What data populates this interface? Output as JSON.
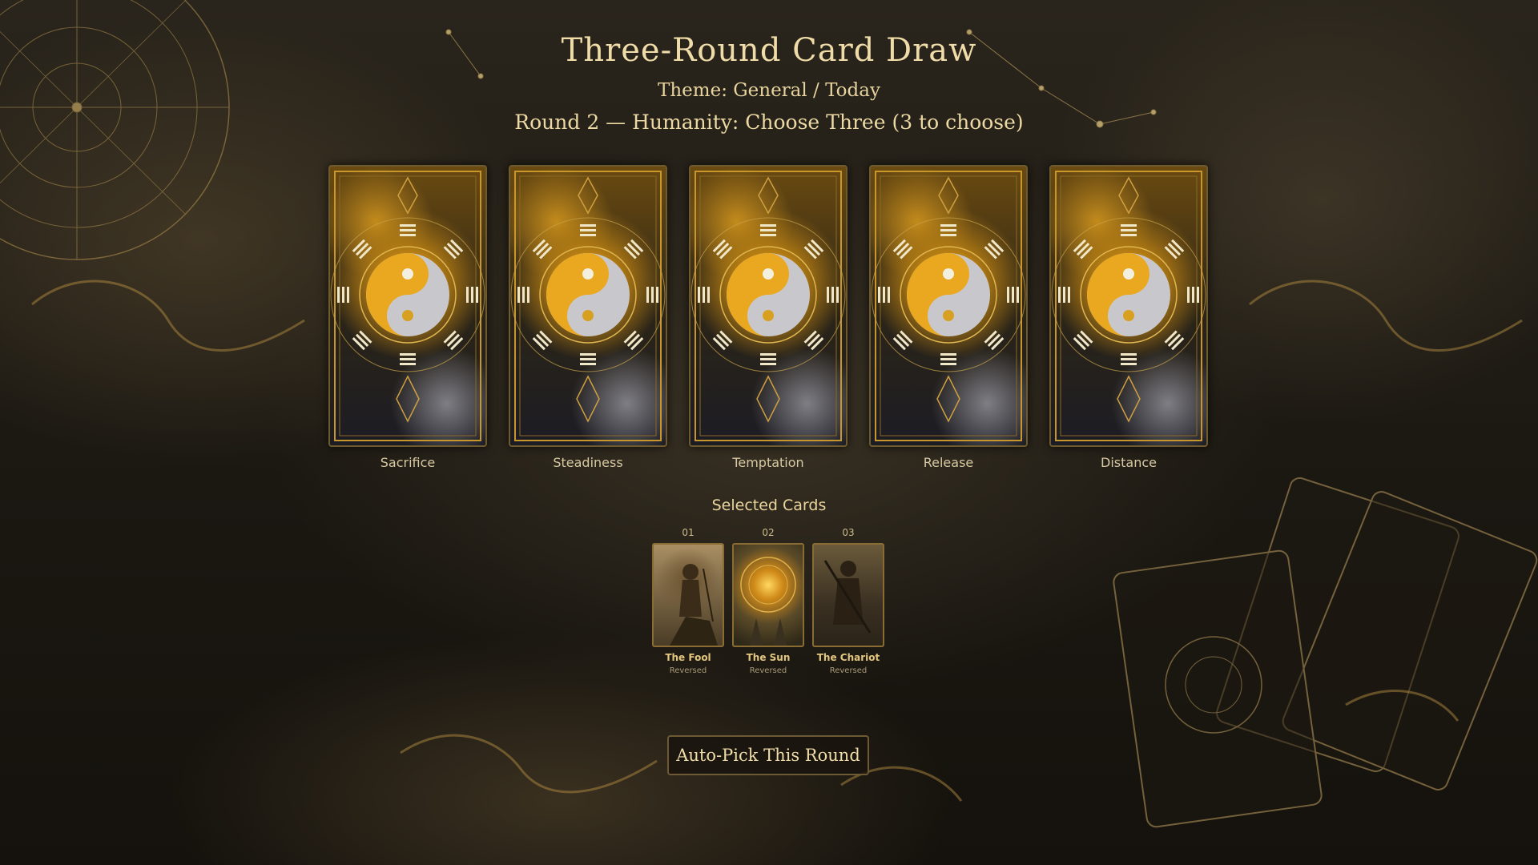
{
  "header": {
    "title": "Three-Round Card Draw",
    "theme": "Theme: General / Today",
    "round": "Round 2 — Humanity: Choose Three (3 to choose)"
  },
  "deck": {
    "cards": [
      {
        "label": "Sacrifice"
      },
      {
        "label": "Steadiness"
      },
      {
        "label": "Temptation"
      },
      {
        "label": "Release"
      },
      {
        "label": "Distance"
      }
    ]
  },
  "selected": {
    "title": "Selected Cards",
    "cards": [
      {
        "number": "01",
        "name": "The Fool",
        "orientation": "Reversed"
      },
      {
        "number": "02",
        "name": "The Sun",
        "orientation": "Reversed"
      },
      {
        "number": "03",
        "name": "The Chariot",
        "orientation": "Reversed"
      }
    ]
  },
  "actions": {
    "auto_pick_label": "Auto-Pick This Round"
  },
  "icons": {
    "card_back_emblem": "yin-yang-bagua-icon",
    "astrolabe": "astrolabe-icon"
  },
  "colors": {
    "accent_gold": "#e8c46a",
    "text_cream": "#f0dca8",
    "background": "#1a1712"
  }
}
